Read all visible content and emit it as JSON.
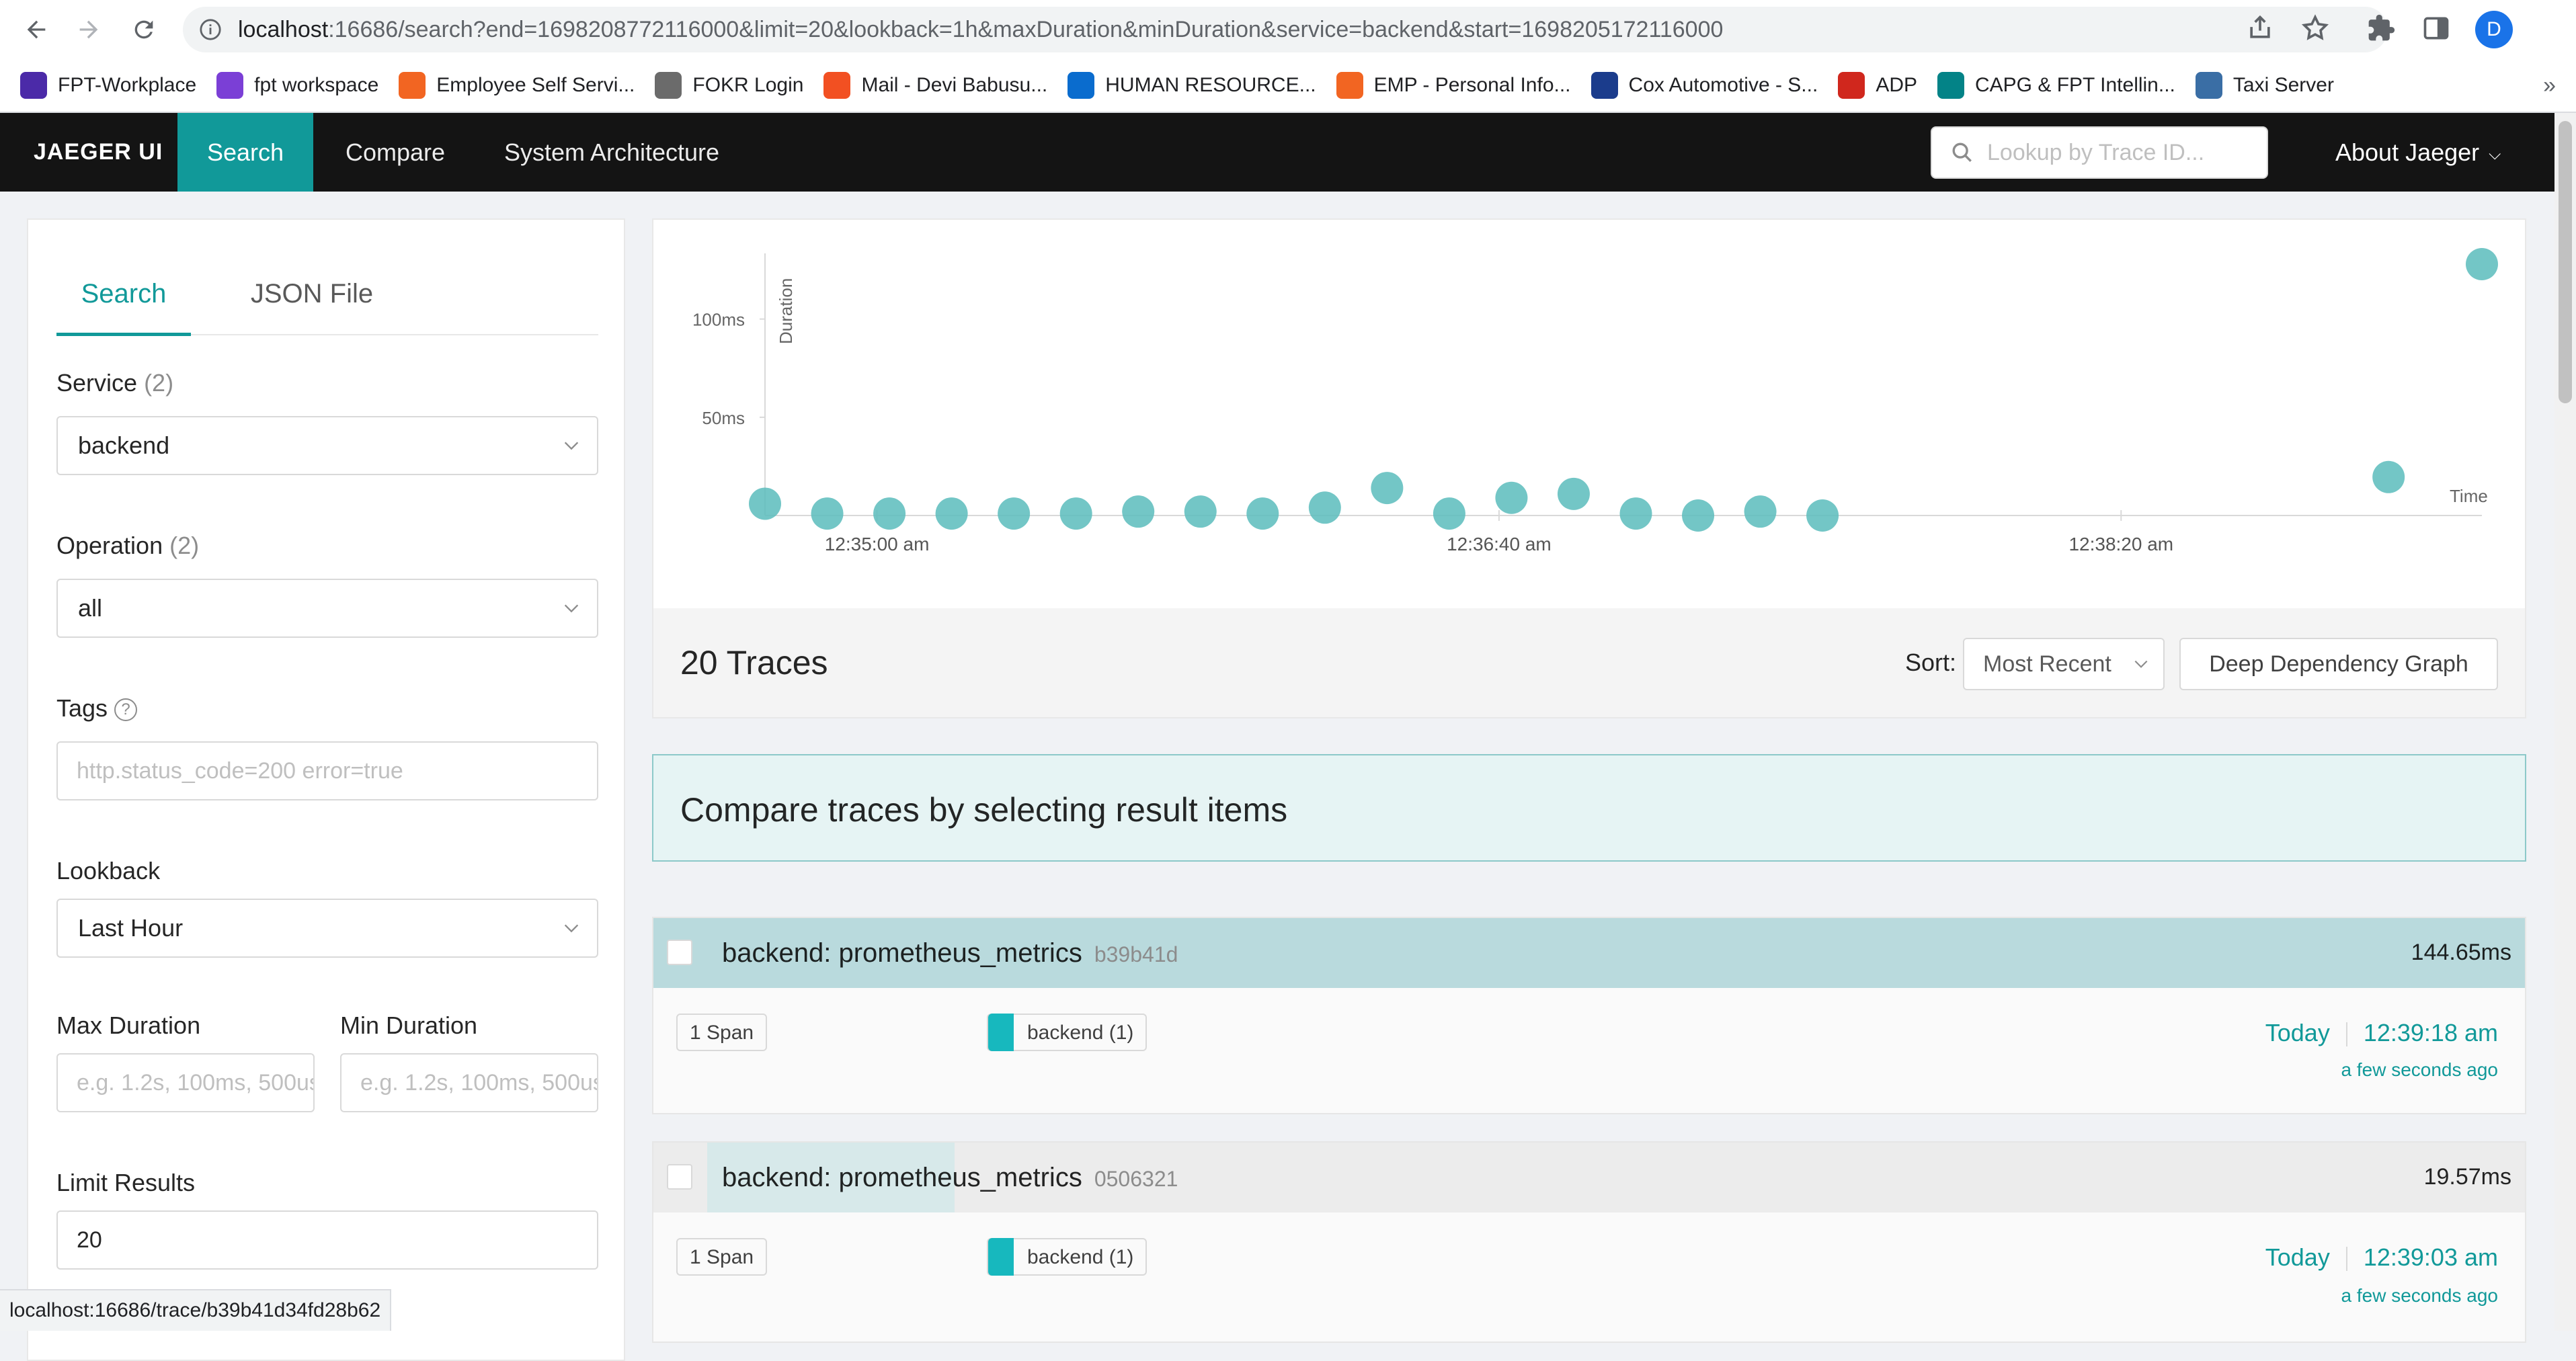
{
  "browser": {
    "url_host": "localhost",
    "url_rest": ":16686/search?end=1698208772116000&limit=20&lookback=1h&maxDuration&minDuration&service=backend&start=1698205172116000",
    "profile_initial": "D",
    "bookmarks": [
      {
        "label": "FPT-Workplace",
        "icon": "workplace-icon",
        "color": "#4b2aa8"
      },
      {
        "label": "fpt workspace",
        "icon": "workplace-icon",
        "color": "#7b3fd6"
      },
      {
        "label": "Employee Self Servi...",
        "icon": "fpt-logo-icon",
        "color": "#f26522"
      },
      {
        "label": "FOKR Login",
        "icon": "globe-icon",
        "color": "#6b6b6b"
      },
      {
        "label": "Mail - Devi Babusu...",
        "icon": "microsoft-icon",
        "color": "#f25022"
      },
      {
        "label": "HUMAN RESOURCE...",
        "icon": "cloud-icon",
        "color": "#0a6cce"
      },
      {
        "label": "EMP - Personal Info...",
        "icon": "fpt-logo-icon",
        "color": "#f26522"
      },
      {
        "label": "Cox Automotive - S...",
        "icon": "cox-icon",
        "color": "#1b3c8c"
      },
      {
        "label": "ADP",
        "icon": "adp-icon",
        "color": "#d0271d"
      },
      {
        "label": "CAPG & FPT Intellin...",
        "icon": "sharepoint-icon",
        "color": "#038387"
      },
      {
        "label": "Taxi Server",
        "icon": "vmware-icon",
        "color": "#3a6ea5"
      }
    ],
    "bookmarks_more": "»",
    "status_url": "localhost:16686/trace/b39b41d34fd28b62"
  },
  "nav": {
    "brand": "JAEGER UI",
    "items": [
      "Search",
      "Compare",
      "System Architecture"
    ],
    "lookup_placeholder": "Lookup by Trace ID...",
    "about": "About Jaeger"
  },
  "search_form": {
    "tabs": [
      "Search",
      "JSON File"
    ],
    "service_label": "Service",
    "service_count": "(2)",
    "service_value": "backend",
    "operation_label": "Operation",
    "operation_count": "(2)",
    "operation_value": "all",
    "tags_label": "Tags",
    "tags_help": "?",
    "tags_placeholder": "http.status_code=200 error=true",
    "lookback_label": "Lookback",
    "lookback_value": "Last Hour",
    "max_duration_label": "Max Duration",
    "max_duration_placeholder": "e.g. 1.2s, 100ms, 500us",
    "min_duration_label": "Min Duration",
    "min_duration_placeholder": "e.g. 1.2s, 100ms, 500us",
    "limit_label": "Limit Results",
    "limit_value": "20"
  },
  "chart_data": {
    "type": "scatter",
    "ylabel": "Duration",
    "xlabel": "Time",
    "y_ticks": [
      {
        "value": 50,
        "label": "50ms"
      },
      {
        "value": 100,
        "label": "100ms"
      }
    ],
    "x_ticks": [
      "12:35:00 am",
      "12:36:40 am",
      "12:38:20 am"
    ],
    "ylim": [
      0,
      130
    ],
    "points": [
      {
        "x": "12:34:42 am",
        "y": 6
      },
      {
        "x": "12:34:52 am",
        "y": 1
      },
      {
        "x": "12:35:02 am",
        "y": 1
      },
      {
        "x": "12:35:12 am",
        "y": 1
      },
      {
        "x": "12:35:22 am",
        "y": 1
      },
      {
        "x": "12:35:32 am",
        "y": 1
      },
      {
        "x": "12:35:42 am",
        "y": 2
      },
      {
        "x": "12:35:52 am",
        "y": 2
      },
      {
        "x": "12:36:02 am",
        "y": 1
      },
      {
        "x": "12:36:12 am",
        "y": 4
      },
      {
        "x": "12:36:22 am",
        "y": 14
      },
      {
        "x": "12:36:32 am",
        "y": 1
      },
      {
        "x": "12:36:42 am",
        "y": 9
      },
      {
        "x": "12:36:52 am",
        "y": 11
      },
      {
        "x": "12:37:02 am",
        "y": 1
      },
      {
        "x": "12:37:12 am",
        "y": 0
      },
      {
        "x": "12:37:22 am",
        "y": 2
      },
      {
        "x": "12:37:32 am",
        "y": 0
      },
      {
        "x": "12:39:03 am",
        "y": 19.57
      },
      {
        "x": "12:39:18 am",
        "y": 144.65
      }
    ],
    "point_color": "#5bbcbc"
  },
  "results": {
    "count_label": "20 Traces",
    "sort_label": "Sort:",
    "sort_value": "Most Recent",
    "ddg_button": "Deep Dependency Graph",
    "compare_banner": "Compare traces by selecting result items",
    "traces": [
      {
        "title": "backend: prometheus_metrics",
        "id": "b39b41d",
        "duration": "144.65ms",
        "spans": "1 Span",
        "service": "backend (1)",
        "day": "Today",
        "time": "12:39:18 am",
        "ago": "a few seconds ago"
      },
      {
        "title": "backend: prometheus_metrics",
        "id": "0506321",
        "duration": "19.57ms",
        "spans": "1 Span",
        "service": "backend (1)",
        "day": "Today",
        "time": "12:39:03 am",
        "ago": "a few seconds ago"
      }
    ]
  },
  "colors": {
    "accent": "#119999",
    "nav_bg": "#141414",
    "service": "#17b8be"
  }
}
